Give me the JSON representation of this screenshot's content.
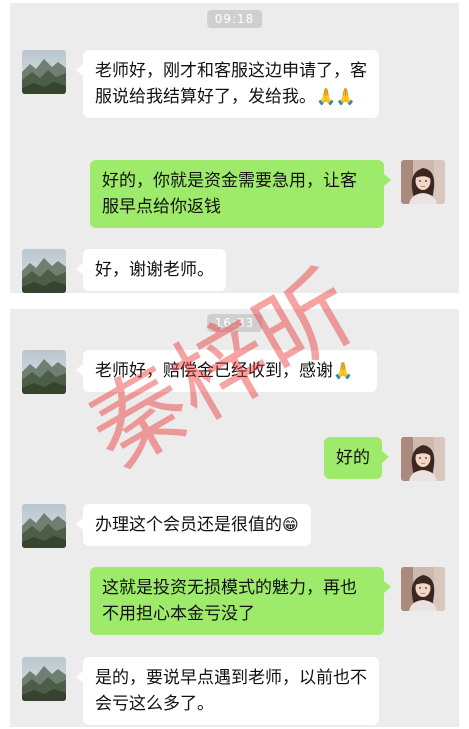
{
  "panel1": {
    "timestamp": "09:18",
    "messages": [
      {
        "side": "left",
        "text": "老师好，刚才和客服这边申请了，客服说给我结算好了，发给我。",
        "emoji": "🙏🙏"
      },
      {
        "side": "right",
        "text": "好的，你就是资金需要急用，让客服早点给你返钱",
        "emoji": ""
      },
      {
        "side": "left",
        "text": "好，谢谢老师。",
        "emoji": ""
      }
    ]
  },
  "panel2": {
    "timestamp": "16:33",
    "messages": [
      {
        "side": "left",
        "text": "老师好，赔偿金已经收到，感谢",
        "emoji": "🙏"
      },
      {
        "side": "right",
        "text": "好的",
        "emoji": ""
      },
      {
        "side": "left",
        "text": "办理这个会员还是很值的",
        "emoji": "😁"
      },
      {
        "side": "right",
        "text": "这就是投资无损模式的魅力，再也不用担心本金亏没了",
        "emoji": ""
      },
      {
        "side": "left",
        "text": "是的，要说早点遇到老师，以前也不会亏这么多了。",
        "emoji": ""
      }
    ]
  },
  "watermark": "秦梓昕",
  "colors": {
    "chat_bg": "#ececec",
    "bubble_right": "#9eea6a",
    "bubble_left": "#ffffff",
    "watermark": "#e83232"
  },
  "icons": {
    "user_avatar": "mountain-landscape-avatar",
    "teacher_avatar": "woman-portrait-avatar"
  }
}
